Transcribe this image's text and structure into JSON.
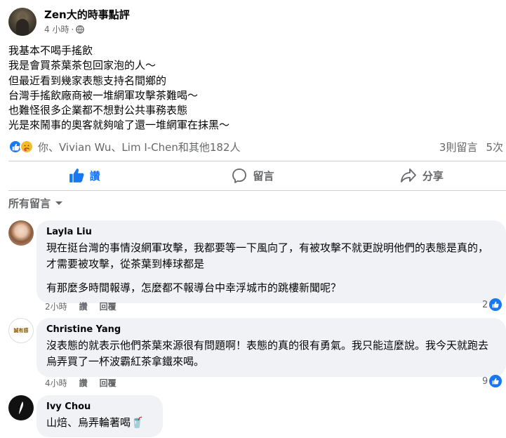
{
  "post": {
    "page_name": "Zen大的時事點評",
    "time": "4 小時",
    "dot": "·",
    "lines": [
      "我基本不喝手搖飲",
      "我是會買茶葉茶包回家泡的人～",
      "但最近看到幾家表態支持名間鄉的",
      "台灣手搖飲廠商被一堆網軍攻擊茶難喝～",
      "也難怪很多企業都不想對公共事務表態",
      "光是來鬧事的奧客就夠嗆了還一堆網軍在抹黑～"
    ],
    "reaction_summary": "你、Vivian Wu、Lim I-Chen和其他182人",
    "comment_count": "3則留言",
    "share_count": "5次"
  },
  "actions": {
    "like": "讚",
    "comment": "留言",
    "share": "分享"
  },
  "comments_filter": "所有留言",
  "comments": [
    {
      "author": "Layla Liu",
      "paragraphs": [
        "現在挺台灣的事情沒網軍攻擊，我都要等一下風向了，有被攻擊不就更說明他們的表態是真的，才需要被攻擊，從茶葉到棒球都是",
        "有那麼多時間報導，怎麼都不報導台中幸浮城市的跳樓新聞呢？"
      ],
      "time": "2小時",
      "like": "讚",
      "reply": "回覆",
      "likes": "2"
    },
    {
      "author": "Christine Yang",
      "avatar_text": "誠有感",
      "paragraphs": [
        "沒表態的就表示他們茶葉來源很有問題啊！表態的真的很有勇氣。我只能這麼說。我今天就跑去烏弄買了一杯波霸紅茶拿鐵來喝。"
      ],
      "time": "4小時",
      "like": "讚",
      "reply": "回覆",
      "likes": "9"
    },
    {
      "author": "Ivy Chou",
      "paragraphs": [
        "山焙、烏弄輪著喝🥤"
      ]
    }
  ],
  "colors": {
    "accent": "#1877f2",
    "secondary_text": "#65676b",
    "bubble": "#f0f2f5"
  }
}
